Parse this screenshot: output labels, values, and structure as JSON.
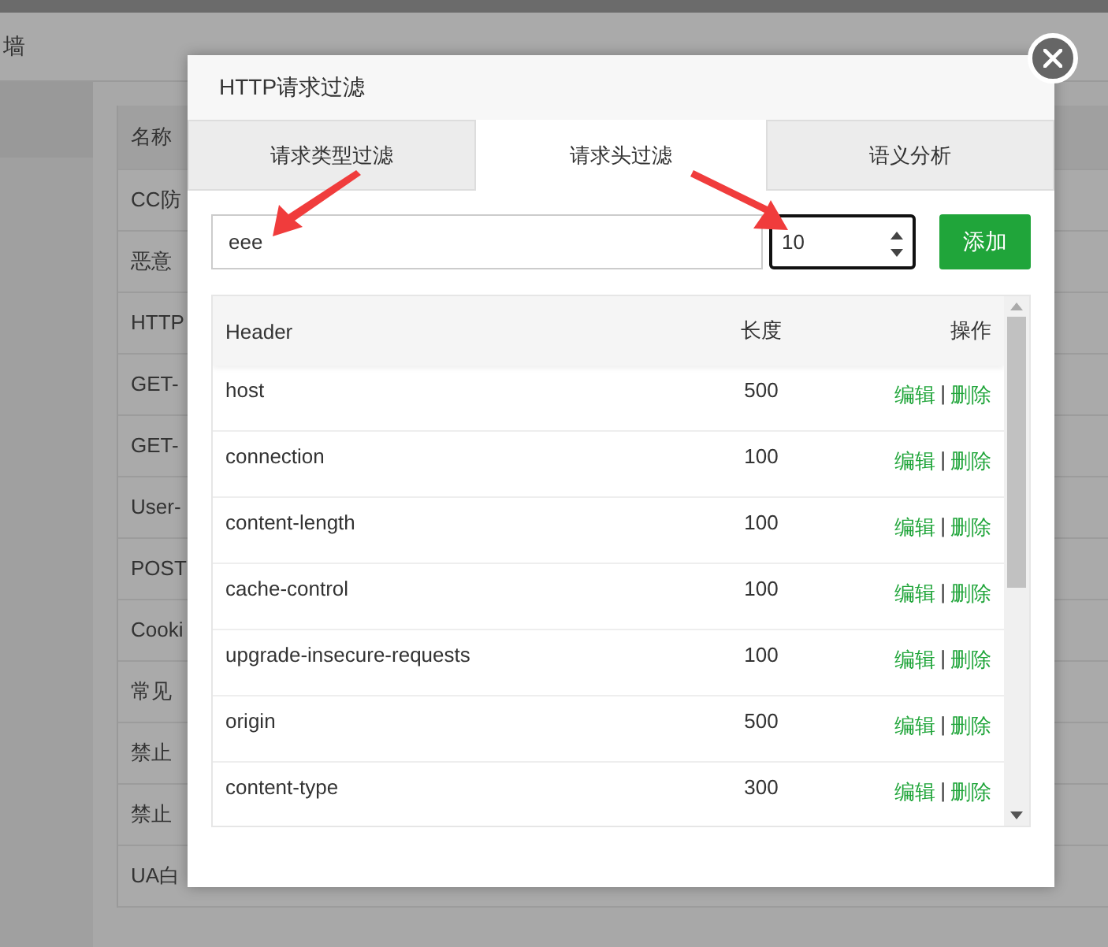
{
  "background_page": {
    "header_text": "墙",
    "table": {
      "column_1": "名称",
      "rows": [
        "CC防",
        "恶意",
        "HTTP",
        "GET-",
        "GET-",
        "User-",
        "POST",
        "Cooki",
        "常见",
        "禁止",
        "禁止",
        "UA白"
      ]
    }
  },
  "dialog": {
    "title": "HTTP请求过滤",
    "tabs": [
      {
        "label": "请求类型过滤",
        "selected": false
      },
      {
        "label": "请求头过滤",
        "selected": true
      },
      {
        "label": "语义分析",
        "selected": false
      }
    ],
    "header_field": {
      "value": "eee"
    },
    "length_field": {
      "value": "10"
    },
    "add_button": "添加",
    "table": {
      "columns": [
        "Header",
        "长度",
        "操作"
      ],
      "rows": [
        {
          "header": "host",
          "length": "500",
          "edit": "编辑",
          "separator": "|",
          "delete": "删除"
        },
        {
          "header": "connection",
          "length": "100",
          "edit": "编辑",
          "separator": "|",
          "delete": "删除"
        },
        {
          "header": "content-length",
          "length": "100",
          "edit": "编辑",
          "separator": "|",
          "delete": "删除"
        },
        {
          "header": "cache-control",
          "length": "100",
          "edit": "编辑",
          "separator": "|",
          "delete": "删除"
        },
        {
          "header": "upgrade-insecure-requests",
          "length": "100",
          "edit": "编辑",
          "separator": "|",
          "delete": "删除"
        },
        {
          "header": "origin",
          "length": "500",
          "edit": "编辑",
          "separator": "|",
          "delete": "删除"
        },
        {
          "header": "content-type",
          "length": "300",
          "edit": "编辑",
          "separator": "|",
          "delete": "删除"
        }
      ]
    }
  }
}
